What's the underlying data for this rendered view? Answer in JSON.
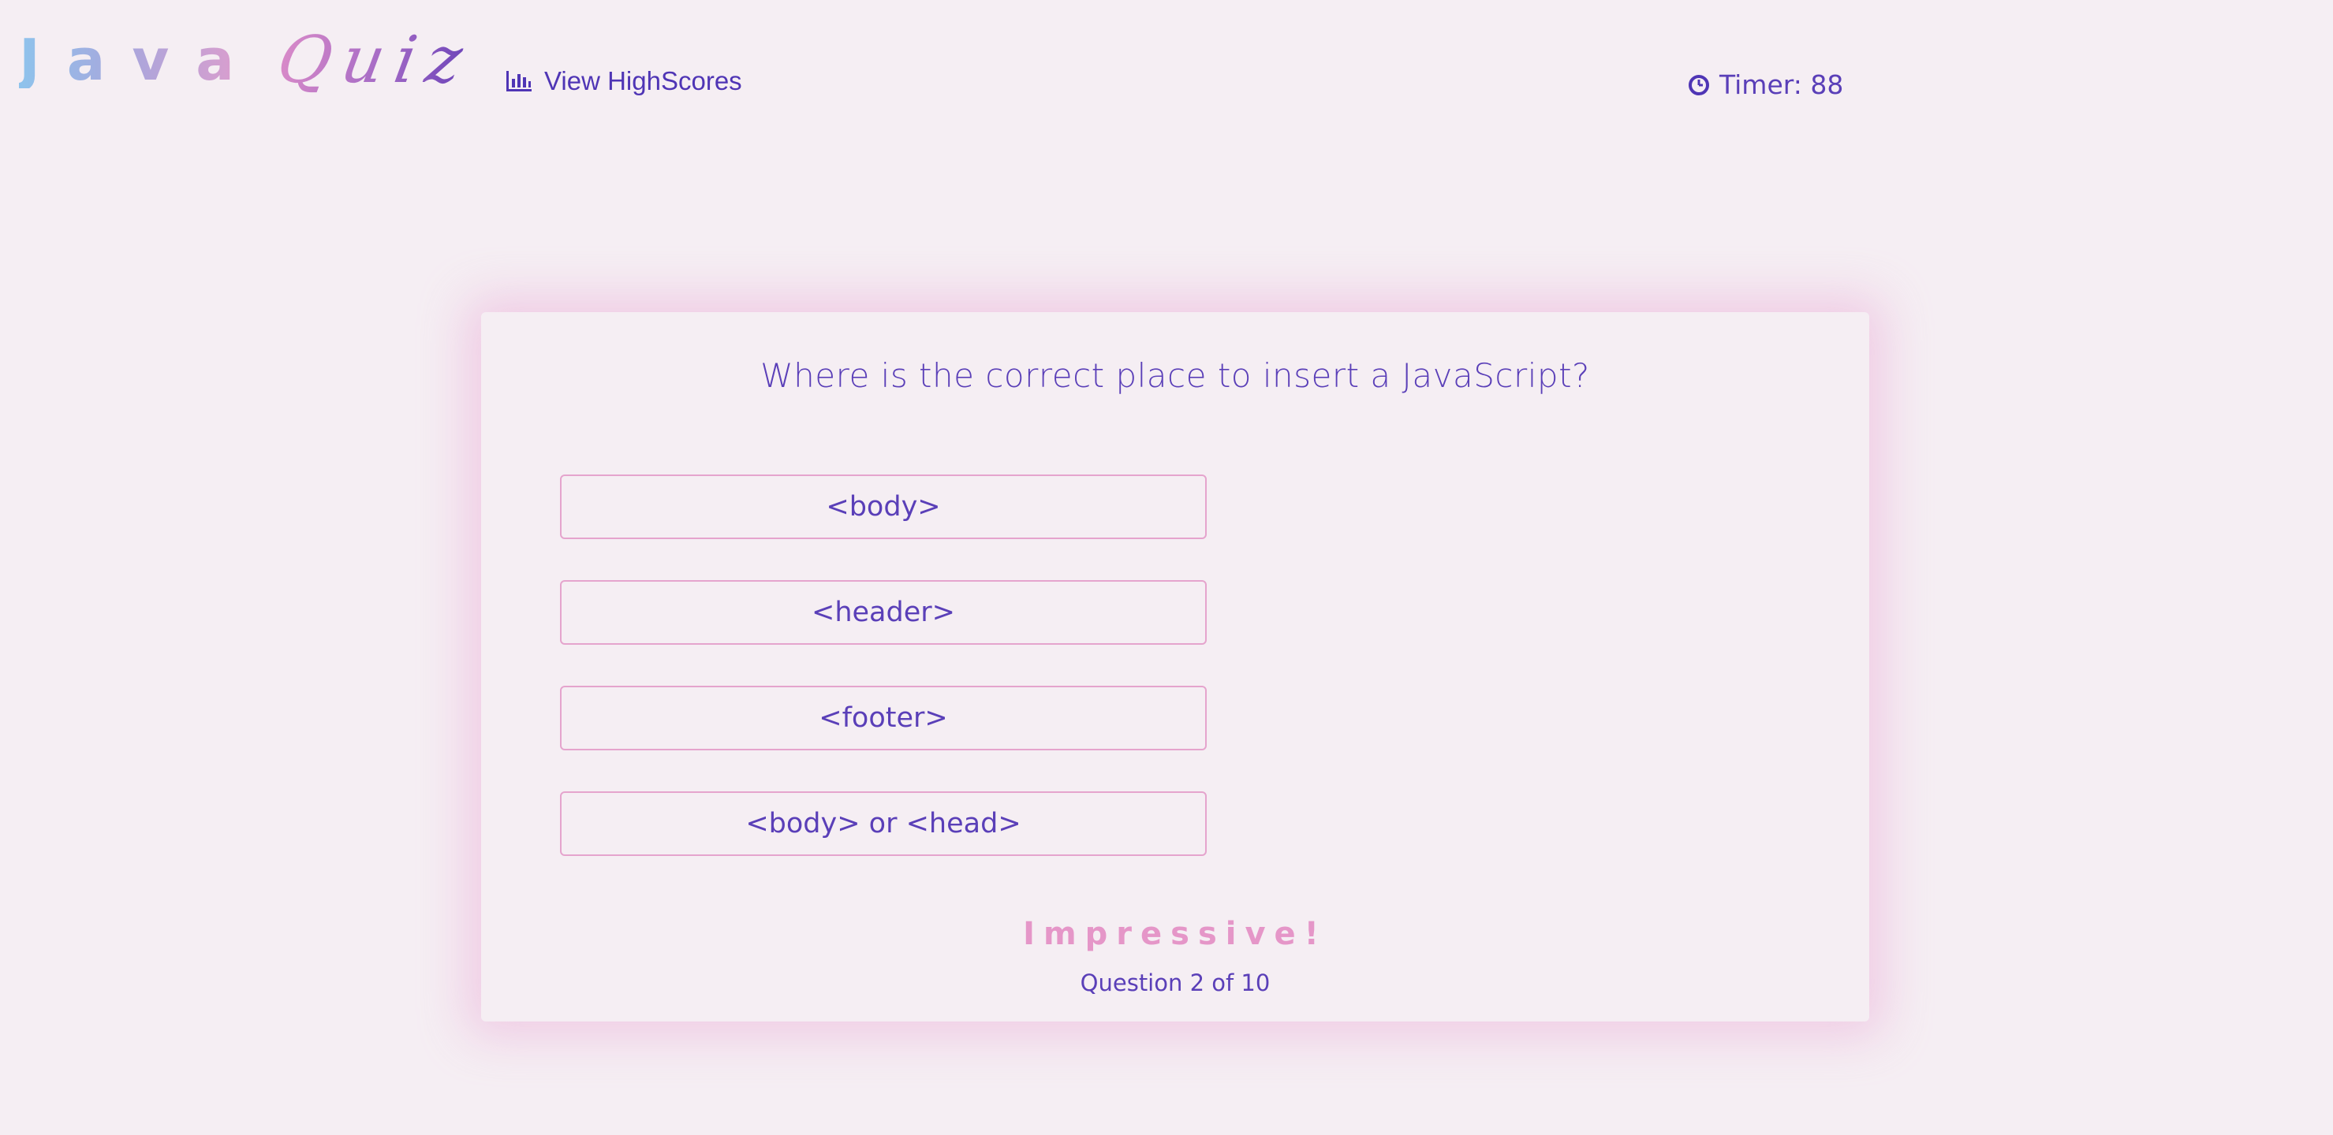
{
  "header": {
    "logo_java": "Java",
    "logo_quiz": "Quiz",
    "highscores_label": "View HighScores",
    "highscores_icon": "bar-chart-icon",
    "timer_icon": "clock-icon",
    "timer_label": "Timer: 88"
  },
  "quiz": {
    "question": "Where is the correct place to insert a JavaScript?",
    "answers": [
      "<body>",
      "<header>",
      "<footer>",
      "<body> or <head>"
    ],
    "feedback": "Impressive!",
    "progress": "Question 2 of 10"
  },
  "colors": {
    "background": "#f5eef3",
    "primary_text": "#5a3fb8",
    "answer_border": "#e5a4cd",
    "feedback": "#e596c8",
    "card_glow": "#e8a0d2"
  }
}
